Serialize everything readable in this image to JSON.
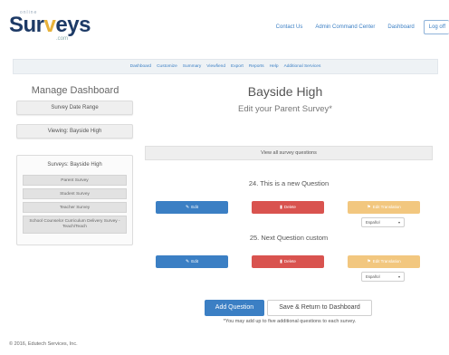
{
  "brand": {
    "top_text": "online",
    "name_prefix": "Sur",
    "name_accent": "v",
    "name_suffix": "eys",
    "sub": ".com",
    "navy": "#1d3a66",
    "gold": "#e8b23a"
  },
  "top_links": {
    "contact": "Contact Us",
    "admin": "Admin Command Center",
    "dashboard": "Dashboard",
    "logoff": "Log off"
  },
  "main_nav": [
    "Dashboard",
    "Customize",
    "Summary",
    "Viewfiend",
    "Export",
    "Reports",
    "Help",
    "Additional Services"
  ],
  "sidebar": {
    "title": "Manage Dashboard",
    "date_range": "Survey Date Range",
    "viewing": "Viewing: Bayside High",
    "surveys_header": "Surveys: Bayside High",
    "surveys": [
      "Parent Survey",
      "Student Survey",
      "Teacher Survey",
      "School Counselor Curriculum Delivery Survey - Teach/Teach"
    ]
  },
  "main": {
    "school": "Bayside High",
    "subtitle": "Edit your Parent Survey*",
    "view_all": "View all survey questions",
    "questions": [
      {
        "text": "24. This is a new Question",
        "edit": "Edit",
        "delete": "Delete",
        "translate": "Edit Translation",
        "lang": "Español"
      },
      {
        "text": "25. Next Question custom",
        "edit": "Edit",
        "delete": "Delete",
        "translate": "Edit Translation",
        "lang": "Español"
      }
    ],
    "add_question": "Add Question",
    "save_return": "Save & Return to Dashboard",
    "note": "*You may add up to five additional questions to each survey."
  },
  "footer": "© 2016, Edutech Services, Inc.",
  "icons": {
    "edit": "pencil-icon",
    "delete": "trash-icon",
    "translate": "flag-icon"
  },
  "colors": {
    "primary": "#3b7fc4",
    "danger": "#d9534f",
    "warning": "#f2c77f"
  }
}
